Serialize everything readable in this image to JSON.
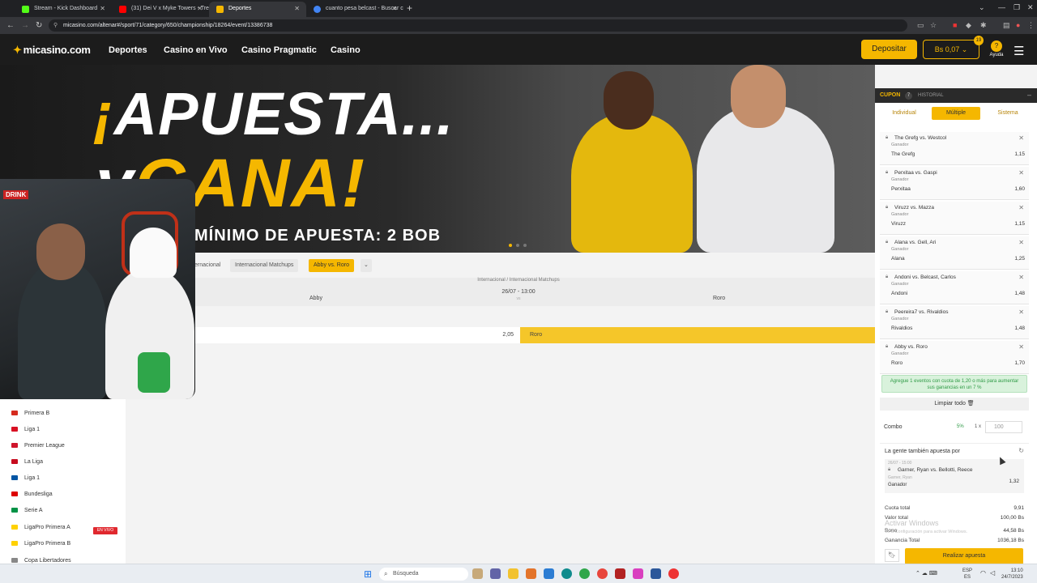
{
  "browser": {
    "tabs": [
      {
        "title": "Stream - Kick Dashboard",
        "fav": "#53fc18"
      },
      {
        "title": "(31) Dei V x Myke Towers - Tre",
        "fav": "#ff0000"
      },
      {
        "title": "Deportes",
        "fav": "#f5b700"
      },
      {
        "title": "cuanto pesa belcast - Buscar c",
        "fav": "#4285f4"
      }
    ],
    "url": "micasino.com/altenar#/sport/71/category/650/championship/18264/event/13386738"
  },
  "header": {
    "logo": "micasino.com",
    "nav": [
      "Deportes",
      "Casino en Vivo",
      "Casino Pragmatic",
      "Casino"
    ],
    "deposit_label": "Depositar",
    "balance": "Bs 0,07",
    "balance_badge": "19",
    "help_label": "Ayuda"
  },
  "banner": {
    "line1_mark": "¡",
    "line1": "APUESTA...",
    "line2_mark": "y",
    "line2": "GANA!",
    "line3": "MÍNIMO DE APUESTA: 2 BOB"
  },
  "breadcrumb": [
    "ernacional",
    "Internacional Matchups",
    "Abby vs. Roro"
  ],
  "event": {
    "category": "Internacional / Internacional Matchups",
    "date": "26/07 - 13:00",
    "vs": "vs",
    "home": "Abby",
    "away": "Roro",
    "home_odd": "2,05",
    "away_label": "Roro"
  },
  "sidebar": {
    "leagues": [
      {
        "name": "Primera B",
        "flag": "#d52b1e"
      },
      {
        "name": "Liga 1",
        "flag": "#d91023"
      },
      {
        "name": "Premier League",
        "flag": "#cf142b"
      },
      {
        "name": "La Liga",
        "flag": "#c60b1e"
      },
      {
        "name": "Liga 1",
        "flag": "#0055a4"
      },
      {
        "name": "Bundesliga",
        "flag": "#dd0000"
      },
      {
        "name": "Serie A",
        "flag": "#009246"
      },
      {
        "name": "LigaPro Primera A",
        "flag": "#ffd100"
      },
      {
        "name": "LigaPro Primera B",
        "flag": "#ffd100"
      },
      {
        "name": "Copa Libertadores",
        "flag": "#888888"
      }
    ],
    "live_badge": "EN VIVO"
  },
  "webcam": {
    "sign": "DRINK"
  },
  "cupon": {
    "title": "CUPON",
    "count": "7",
    "history": "HISTORIAL",
    "tabs": [
      "Individual",
      "Múltiple",
      "Sistema"
    ],
    "bets": [
      {
        "match": "The Grefg vs. Westcol",
        "type": "Ganador",
        "pick": "The Grefg",
        "odd": "1,15"
      },
      {
        "match": "Perxitaa vs. Gaspi",
        "type": "Ganador",
        "pick": "Perxitaa",
        "odd": "1,60"
      },
      {
        "match": "Viruzz vs. Mazza",
        "type": "Ganador",
        "pick": "Viruzz",
        "odd": "1,15"
      },
      {
        "match": "Alana vs. Gell, Ari",
        "type": "Ganador",
        "pick": "Alana",
        "odd": "1,25"
      },
      {
        "match": "Andoni vs. Belcast, Carlos",
        "type": "Ganador",
        "pick": "Andoni",
        "odd": "1,48"
      },
      {
        "match": "Peereira7 vs. Rivaldios",
        "type": "Ganador",
        "pick": "Rivaldios",
        "odd": "1,48"
      },
      {
        "match": "Abby vs. Roro",
        "type": "Ganador",
        "pick": "Roro",
        "odd": "1,70"
      }
    ],
    "promo": "Agregue 1 eventos con cuota de 1,20 o más para aumentar sus ganancias en un 7 %",
    "clear_all": "Limpiar todo",
    "combo_label": "Combo",
    "combo_pct": "5%",
    "combo_mult": "1 x",
    "combo_amount": "100",
    "people_title": "La gente también apuesta por",
    "people_date": "26/07 - 15:00",
    "people_match": "Garner, Ryan vs. Bellotti, Reece",
    "people_pick": "Garner, Ryan",
    "people_type": "Ganador",
    "people_odd": "1,32",
    "summary": [
      {
        "label": "Cuota total",
        "value": "9,91"
      },
      {
        "label": "Valor total",
        "value": "100,00 Bs"
      },
      {
        "label": "Bono",
        "value": "44,58 Bs"
      },
      {
        "label": "Ganancia Total",
        "value": "1036,18 Bs"
      }
    ],
    "place_bet": "Realizar apuesta"
  },
  "watermark": {
    "line1": "Activar Windows",
    "line2": "Ve a Configuración para activar Windows."
  },
  "taskbar": {
    "search": "Búsqueda",
    "lang": "ESP",
    "lang2": "ES",
    "time": "13:10",
    "date": "24/7/2023"
  }
}
